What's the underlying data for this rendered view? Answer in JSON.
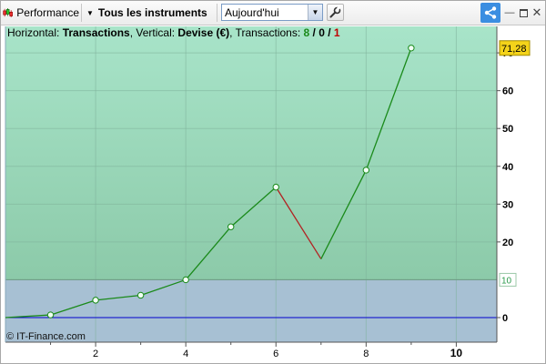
{
  "toolbar": {
    "performance_label": "Performance",
    "instruments_label": "Tous les instruments",
    "period_value": "Aujourd'hui"
  },
  "info": {
    "horizontal_prefix": "Horizontal: ",
    "horizontal_value": "Transactions",
    "vertical_prefix": ", Vertical: ",
    "vertical_value": "Devise (€)",
    "transactions_prefix": ", Transactions: ",
    "winning": "8",
    "slash1": " / ",
    "neutral": "0",
    "slash2": " / ",
    "losing": "1"
  },
  "copyright": "© IT-Finance.com",
  "colors": {
    "toolbar_accent": "#3b8ee1",
    "area_above_threshold": "#9fdcbf",
    "area_below_threshold": "#a7c0d3",
    "winning_segment": "#1a8a1a",
    "losing_segment": "#b22222",
    "zero_line": "#0000cc",
    "last_value_badge": "#f4d31a"
  },
  "chart_data": {
    "type": "line",
    "x": [
      0,
      1,
      2,
      3,
      4,
      5,
      6,
      7,
      8,
      9
    ],
    "y": [
      0,
      0.7,
      4.6,
      5.9,
      10,
      24,
      34.5,
      15.5,
      39,
      71.28
    ],
    "point_markers": [
      1,
      2,
      3,
      4,
      5,
      6,
      8,
      9
    ],
    "losing_segment": [
      6,
      7
    ],
    "xlim": [
      0,
      10.9
    ],
    "ylim": [
      -6.5,
      77
    ],
    "x_ticks": [
      "2",
      "4",
      "6",
      "8",
      "10"
    ],
    "x_tick_values": [
      2,
      4,
      6,
      8,
      10
    ],
    "y_ticks": [
      "0",
      "10",
      "20",
      "30",
      "40",
      "50",
      "60",
      "70"
    ],
    "y_tick_values": [
      0,
      10,
      20,
      30,
      40,
      50,
      60,
      70
    ],
    "threshold_value": 10,
    "threshold_label": "10",
    "zero_line_value": 0,
    "last_value_label": "71,28",
    "grid": true
  }
}
